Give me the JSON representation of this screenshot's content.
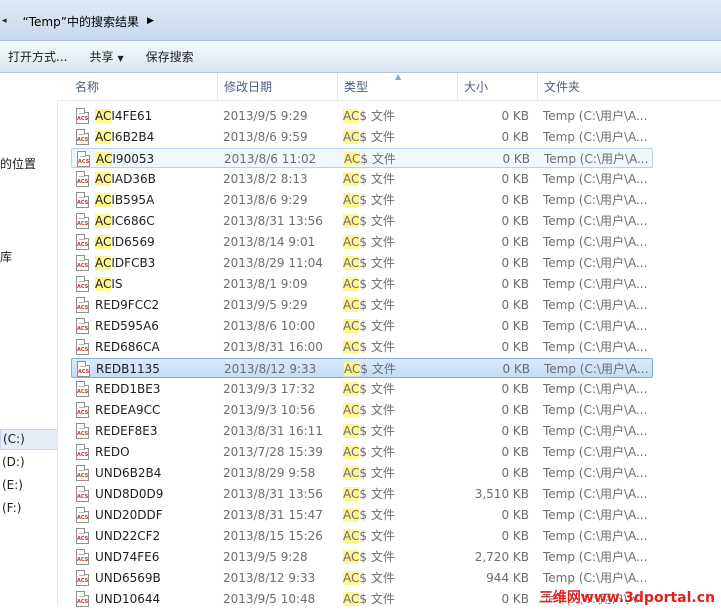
{
  "address": {
    "text": "“Temp”中的搜索结果"
  },
  "toolbar": {
    "open_with": "打开方式...",
    "share": "共享",
    "save_search": "保存搜索"
  },
  "nav": {
    "locations_partial": "的位置",
    "library_partial": "库",
    "drives": [
      "(C:)",
      "(D:)",
      "(E:)",
      "(F:)"
    ]
  },
  "columns": {
    "name": "名称",
    "date": "修改日期",
    "type": "类型",
    "size": "大小",
    "folder": "文件夹"
  },
  "icon": {
    "label": "ACS",
    "name": "acs-file-icon"
  },
  "rows": [
    {
      "hl": "AC",
      "rest": "I4FE61",
      "date": "2013/9/5 9:29",
      "type_hl": "AC",
      "type_rest": "$ 文件",
      "size": "0 KB",
      "folder": "Temp (C:\\用户\\A..."
    },
    {
      "hl": "AC",
      "rest": "I6B2B4",
      "date": "2013/8/6 9:59",
      "type_hl": "AC",
      "type_rest": "$ 文件",
      "size": "0 KB",
      "folder": "Temp (C:\\用户\\A..."
    },
    {
      "hl": "AC",
      "rest": "I90053",
      "date": "2013/8/6 11:02",
      "type_hl": "AC",
      "type_rest": "$ 文件",
      "size": "0 KB",
      "folder": "Temp (C:\\用户\\A..."
    },
    {
      "hl": "AC",
      "rest": "IAD36B",
      "date": "2013/8/2 8:13",
      "type_hl": "AC",
      "type_rest": "$ 文件",
      "size": "0 KB",
      "folder": "Temp (C:\\用户\\A..."
    },
    {
      "hl": "AC",
      "rest": "IB595A",
      "date": "2013/8/6 9:29",
      "type_hl": "AC",
      "type_rest": "$ 文件",
      "size": "0 KB",
      "folder": "Temp (C:\\用户\\A..."
    },
    {
      "hl": "AC",
      "rest": "IC686C",
      "date": "2013/8/31 13:56",
      "type_hl": "AC",
      "type_rest": "$ 文件",
      "size": "0 KB",
      "folder": "Temp (C:\\用户\\A..."
    },
    {
      "hl": "AC",
      "rest": "ID6569",
      "date": "2013/8/14 9:01",
      "type_hl": "AC",
      "type_rest": "$ 文件",
      "size": "0 KB",
      "folder": "Temp (C:\\用户\\A..."
    },
    {
      "hl": "AC",
      "rest": "IDFCB3",
      "date": "2013/8/29 11:04",
      "type_hl": "AC",
      "type_rest": "$ 文件",
      "size": "0 KB",
      "folder": "Temp (C:\\用户\\A..."
    },
    {
      "hl": "AC",
      "rest": "IS",
      "date": "2013/8/1 9:09",
      "type_hl": "AC",
      "type_rest": "$ 文件",
      "size": "0 KB",
      "folder": "Temp (C:\\用户\\A..."
    },
    {
      "hl": "",
      "rest": "RED9FCC2",
      "date": "2013/9/5 9:29",
      "type_hl": "AC",
      "type_rest": "$ 文件",
      "size": "0 KB",
      "folder": "Temp (C:\\用户\\A..."
    },
    {
      "hl": "",
      "rest": "RED595A6",
      "date": "2013/8/6 10:00",
      "type_hl": "AC",
      "type_rest": "$ 文件",
      "size": "0 KB",
      "folder": "Temp (C:\\用户\\A..."
    },
    {
      "hl": "",
      "rest": "RED686CA",
      "date": "2013/8/31 16:00",
      "type_hl": "AC",
      "type_rest": "$ 文件",
      "size": "0 KB",
      "folder": "Temp (C:\\用户\\A..."
    },
    {
      "hl": "",
      "rest": "REDB1135",
      "date": "2013/8/12 9:33",
      "type_hl": "AC",
      "type_rest": "$ 文件",
      "size": "0 KB",
      "folder": "Temp (C:\\用户\\A..."
    },
    {
      "hl": "",
      "rest": "REDD1BE3",
      "date": "2013/9/3 17:32",
      "type_hl": "AC",
      "type_rest": "$ 文件",
      "size": "0 KB",
      "folder": "Temp (C:\\用户\\A..."
    },
    {
      "hl": "",
      "rest": "REDEA9CC",
      "date": "2013/9/3 10:56",
      "type_hl": "AC",
      "type_rest": "$ 文件",
      "size": "0 KB",
      "folder": "Temp (C:\\用户\\A..."
    },
    {
      "hl": "",
      "rest": "REDEF8E3",
      "date": "2013/8/31 16:11",
      "type_hl": "AC",
      "type_rest": "$ 文件",
      "size": "0 KB",
      "folder": "Temp (C:\\用户\\A..."
    },
    {
      "hl": "",
      "rest": "REDO",
      "date": "2013/7/28 15:39",
      "type_hl": "AC",
      "type_rest": "$ 文件",
      "size": "0 KB",
      "folder": "Temp (C:\\用户\\A..."
    },
    {
      "hl": "",
      "rest": "UND6B2B4",
      "date": "2013/8/29 9:58",
      "type_hl": "AC",
      "type_rest": "$ 文件",
      "size": "0 KB",
      "folder": "Temp (C:\\用户\\A..."
    },
    {
      "hl": "",
      "rest": "UND8D0D9",
      "date": "2013/8/31 13:56",
      "type_hl": "AC",
      "type_rest": "$ 文件",
      "size": "3,510 KB",
      "folder": "Temp (C:\\用户\\A..."
    },
    {
      "hl": "",
      "rest": "UND20DDF",
      "date": "2013/8/31 15:47",
      "type_hl": "AC",
      "type_rest": "$ 文件",
      "size": "0 KB",
      "folder": "Temp (C:\\用户\\A..."
    },
    {
      "hl": "",
      "rest": "UND22CF2",
      "date": "2013/8/15 15:26",
      "type_hl": "AC",
      "type_rest": "$ 文件",
      "size": "0 KB",
      "folder": "Temp (C:\\用户\\A..."
    },
    {
      "hl": "",
      "rest": "UND74FE6",
      "date": "2013/9/5 9:28",
      "type_hl": "AC",
      "type_rest": "$ 文件",
      "size": "2,720 KB",
      "folder": "Temp (C:\\用户\\A..."
    },
    {
      "hl": "",
      "rest": "UND6569B",
      "date": "2013/8/12 9:33",
      "type_hl": "AC",
      "type_rest": "$ 文件",
      "size": "944 KB",
      "folder": "Temp (C:\\用户\\A..."
    },
    {
      "hl": "",
      "rest": "UND10644",
      "date": "2013/9/5 10:48",
      "type_hl": "AC",
      "type_rest": "$ 文件",
      "size": "0 KB",
      "folder": "Temp (C:\\用户\\A..."
    }
  ],
  "hover_row": 2,
  "selected_row": 12,
  "watermark": "三维网www.3dportal.cn",
  "colors": {
    "highlight": "#fff68f",
    "selection": "#c4dcf7"
  }
}
